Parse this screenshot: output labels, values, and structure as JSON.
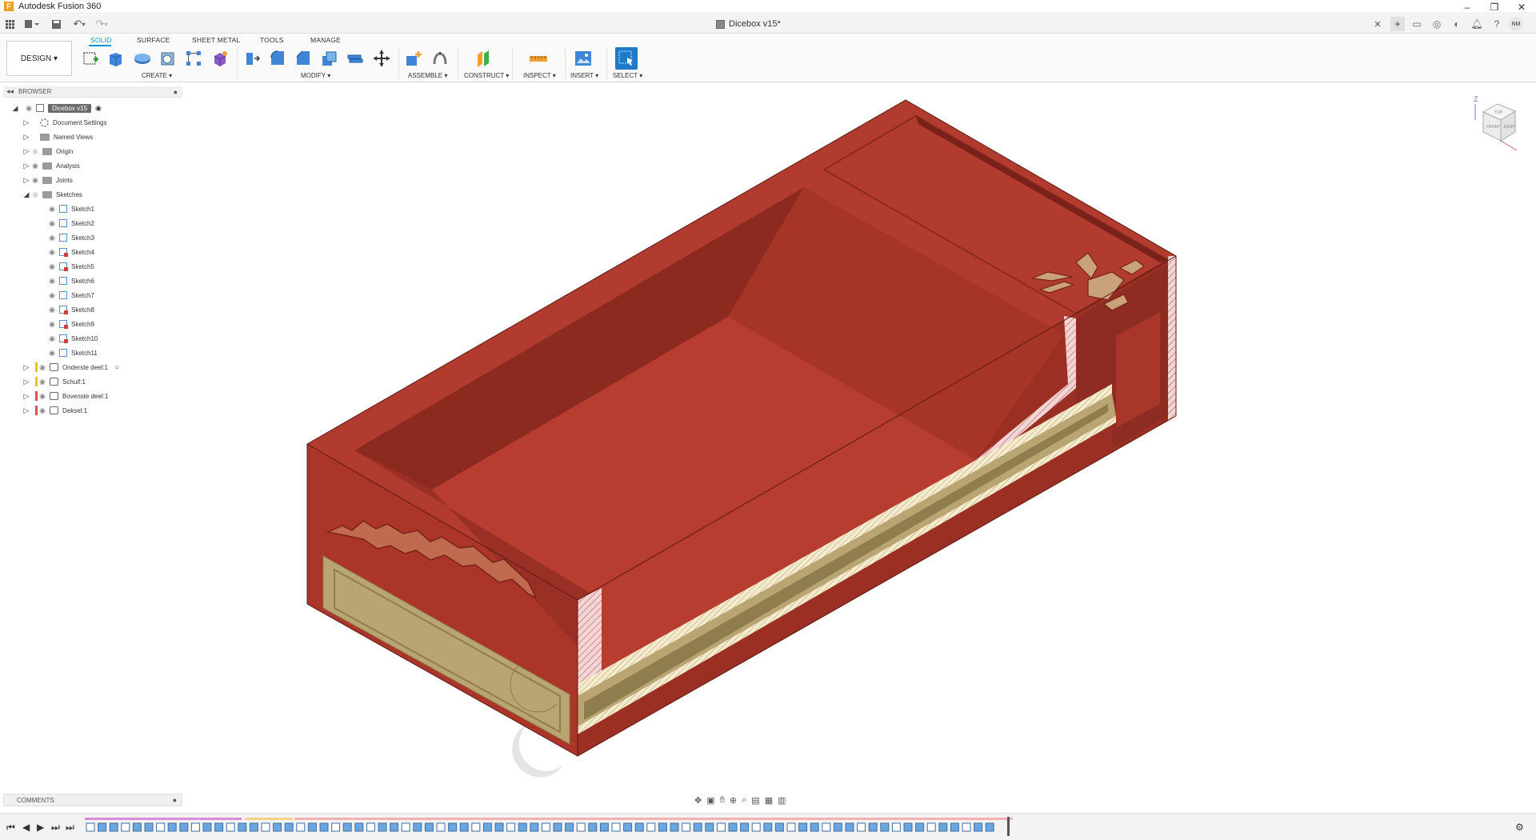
{
  "app": {
    "title": "Autodesk Fusion 360",
    "logo_letter": "F"
  },
  "document": {
    "tab_title": "Dicebox v15*"
  },
  "user": {
    "initials": "NM"
  },
  "workspace": {
    "label": "DESIGN ▾"
  },
  "ribbon": {
    "tabs": [
      "SOLID",
      "SURFACE",
      "SHEET METAL",
      "TOOLS",
      "MANAGE"
    ],
    "active_tab": "SOLID",
    "groups": {
      "create": "CREATE ▾",
      "modify": "MODIFY ▾",
      "assemble": "ASSEMBLE ▾",
      "construct": "CONSTRUCT ▾",
      "inspect": "INSPECT ▾",
      "insert": "INSERT ▾",
      "select": "SELECT ▾"
    }
  },
  "browser": {
    "header": "BROWSER",
    "root": "Dicebox v15",
    "items": [
      {
        "label": "Document Settings"
      },
      {
        "label": "Named Views"
      },
      {
        "label": "Origin"
      },
      {
        "label": "Analysis"
      },
      {
        "label": "Joints"
      },
      {
        "label": "Sketches"
      }
    ],
    "sketches": [
      "Sketch1",
      "Sketch2",
      "Sketch3",
      "Sketch4",
      "Sketch5",
      "Sketch6",
      "Sketch7",
      "Sketch8",
      "Sketch9",
      "Sketch10",
      "Sketch11"
    ],
    "components": [
      "Onderste deel:1",
      "Schuif:1",
      "Bovenste deel:1",
      "Deksel:1"
    ]
  },
  "comments": {
    "label": "COMMENTS"
  },
  "viewcube": {
    "axis_label": "Z",
    "faces": [
      "TOP",
      "FRONT",
      "RIGHT"
    ]
  },
  "colors": {
    "accent": "#0696d7",
    "model_red": "#b03a2e",
    "model_red_dark": "#8e2b22",
    "model_tan": "#b8a572"
  }
}
